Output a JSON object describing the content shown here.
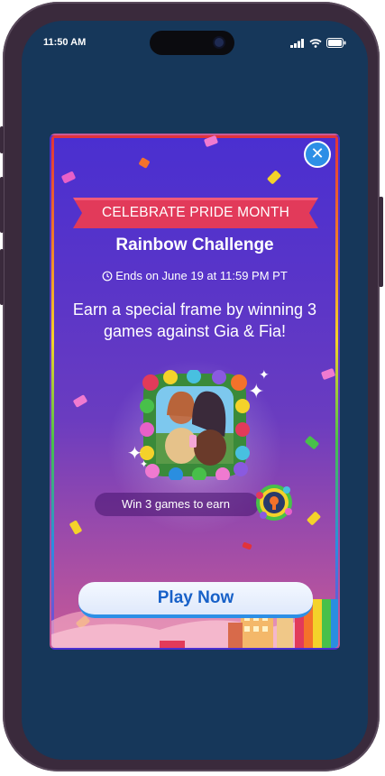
{
  "status_bar": {
    "time": "11:50 AM"
  },
  "modal": {
    "ribbon": "CELEBRATE PRIDE MONTH",
    "title": "Rainbow Challenge",
    "ends": "Ends on June 19 at 11:59 PM PT",
    "description": "Earn a special frame by winning 3 games against Gia & Fia!",
    "earn_label": "Win 3 games to earn",
    "play_button": "Play Now",
    "close_label": "✕"
  },
  "colors": {
    "background": "#16375a",
    "ribbon": "#e23a5a",
    "play_text": "#1861c8",
    "close_button": "#2d8fe6"
  },
  "icons": [
    "signal-icon",
    "wifi-icon",
    "battery-icon",
    "close-icon",
    "clock-icon",
    "frame-art-image",
    "badge-icon"
  ]
}
